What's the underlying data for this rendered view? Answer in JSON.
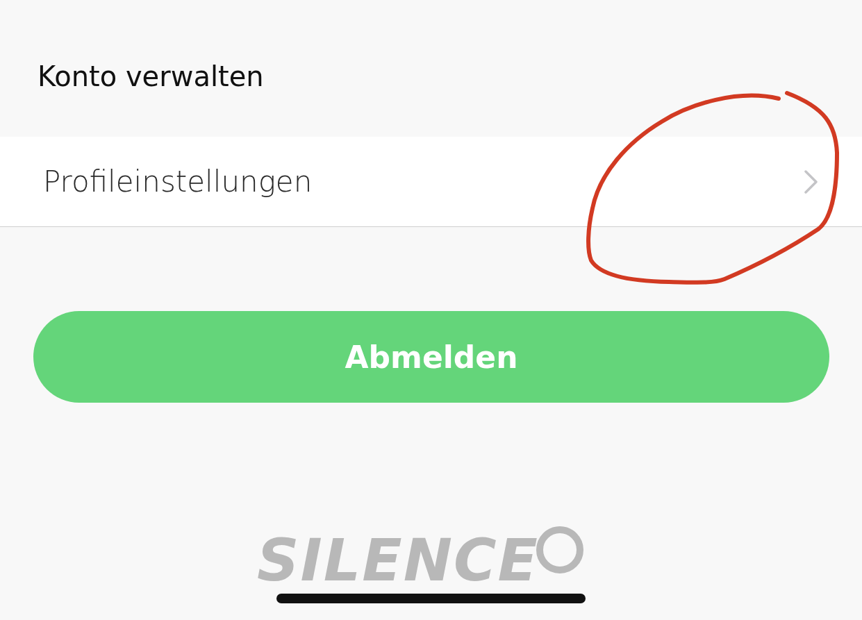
{
  "section_title": "Konto verwalten",
  "menu_items": [
    {
      "label": "Profileinstellungen"
    }
  ],
  "logout_button": {
    "label": "Abmelden"
  },
  "logo": {
    "text": "SILENCE"
  }
}
